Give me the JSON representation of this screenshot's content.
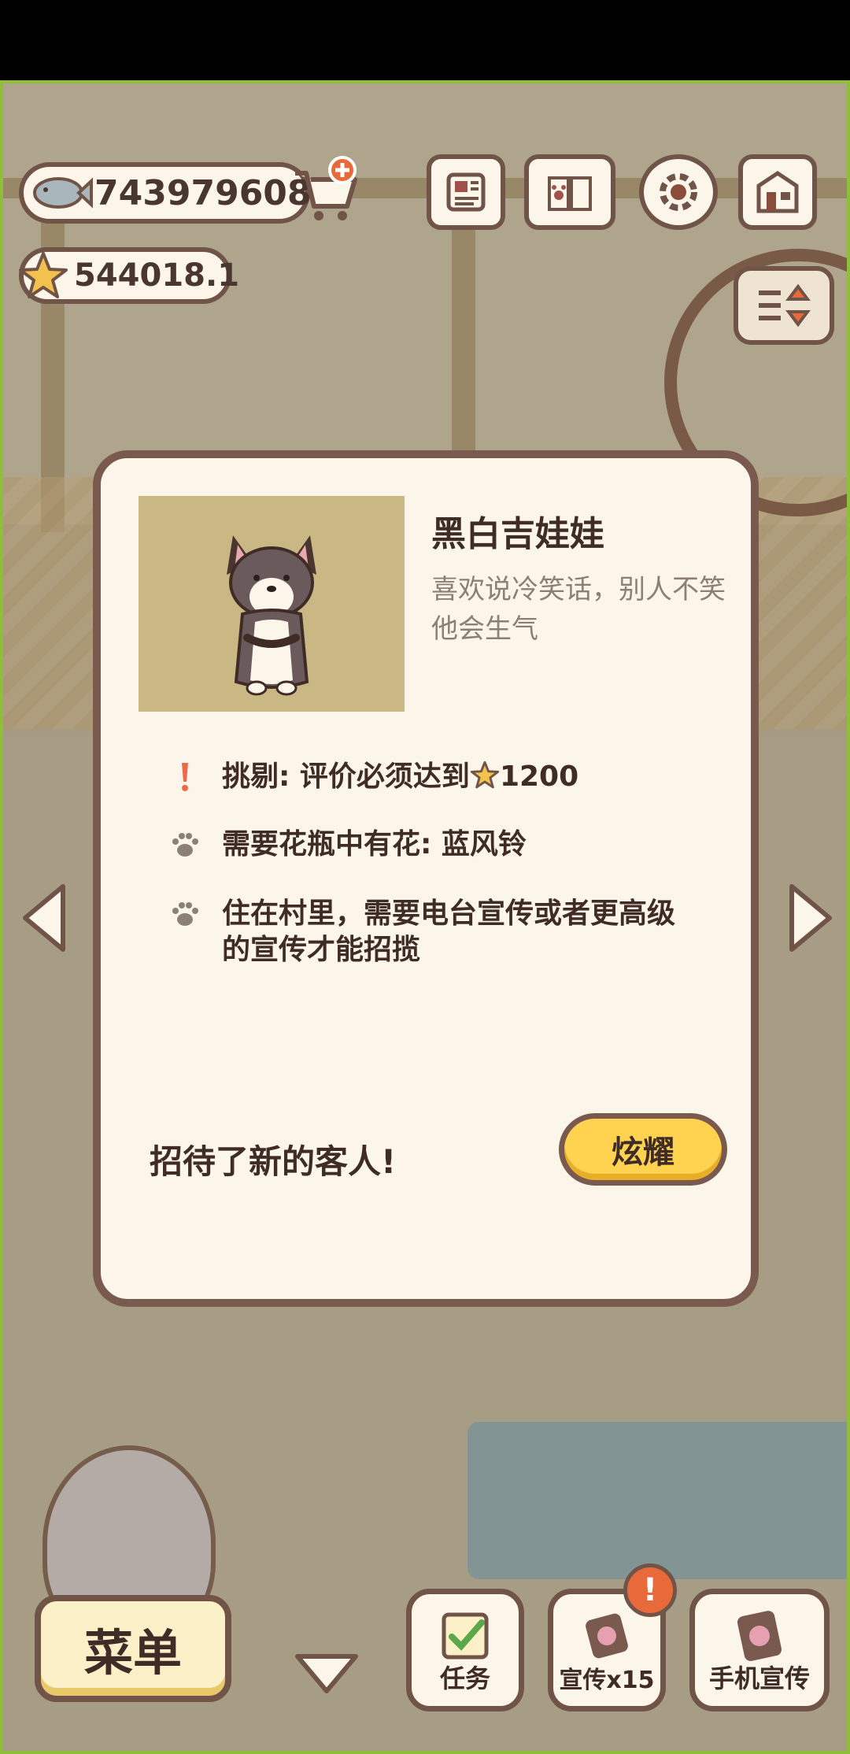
{
  "hud": {
    "fish_count": "743979608",
    "star_rating": "544018.1"
  },
  "customer": {
    "name": "黑白吉娃娃",
    "description": "喜欢说冷笑话，别人不笑他会生气",
    "requirements": [
      {
        "icon": "exclamation-icon",
        "text_prefix": "挑剔: 评价必须达到",
        "value": "1200"
      },
      {
        "icon": "paw-icon",
        "text": "需要花瓶中有花: 蓝风铃"
      },
      {
        "icon": "paw-icon",
        "text": "住在村里，需要电台宣传或者更高级的宣传才能招揽"
      }
    ]
  },
  "modal": {
    "footer_text": "招待了新的客人!",
    "show_button": "炫耀"
  },
  "bottom_bar": {
    "menu_label": "菜单",
    "task_label": "任务",
    "promo_label": "宣传x15",
    "phone_promo_label": "手机宣传",
    "alert_badge": "!"
  },
  "colors": {
    "accent_yellow": "#ffd24f",
    "border_brown": "#7a5a4e",
    "panel_cream": "#fbf5ea",
    "portrait_bg": "#c9b784",
    "alert_orange": "#e86a3a"
  }
}
